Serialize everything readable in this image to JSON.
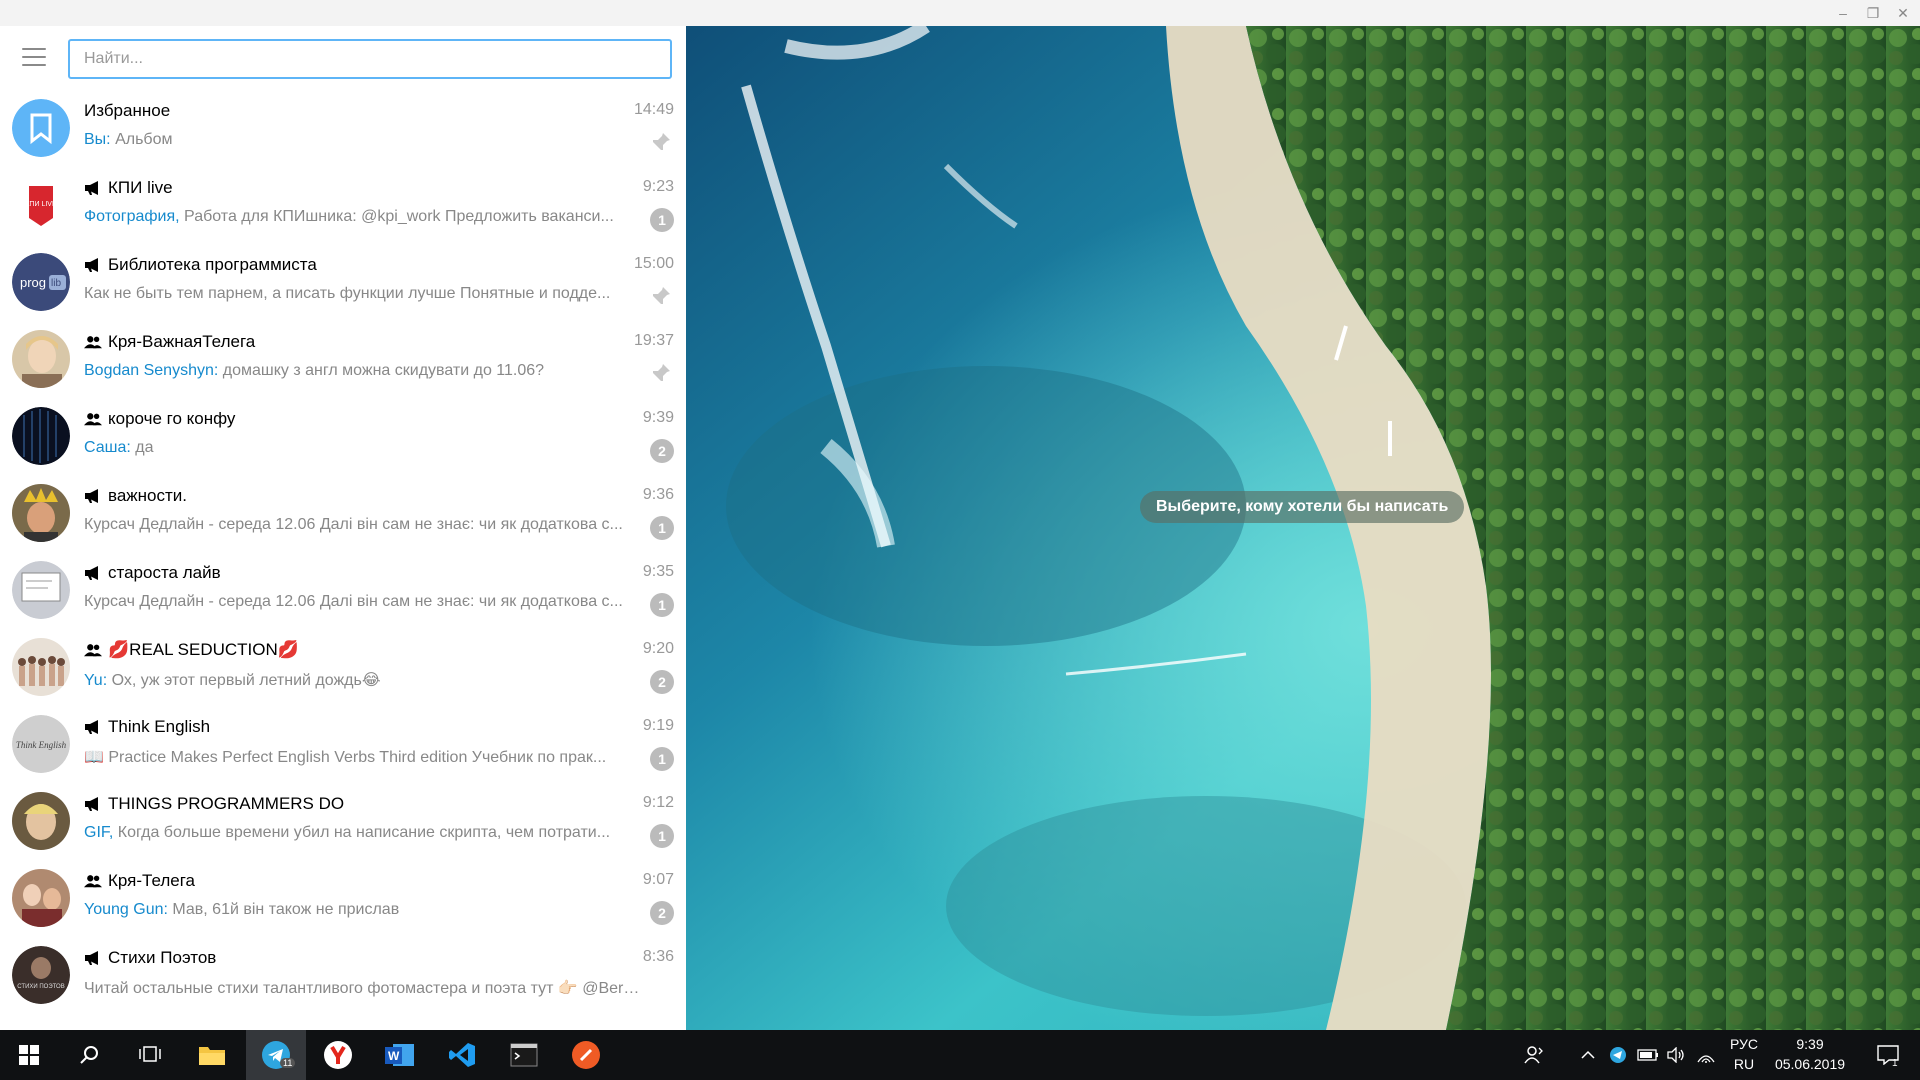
{
  "window": {
    "minimize": "‒",
    "restore": "❐",
    "close": "✕"
  },
  "search": {
    "placeholder": "Найти..."
  },
  "chats": [
    {
      "title": "Избранное",
      "type": "saved",
      "time": "14:49",
      "sender": "Вы:",
      "text": " Альбом",
      "pinned": true,
      "unread": ""
    },
    {
      "title": "КПИ live",
      "type": "channel",
      "time": "9:23",
      "sender": "Фотография,",
      "text": " Работа для КПИшника: @kpi_work  Предложить ваканси...",
      "pinned": false,
      "unread": "1"
    },
    {
      "title": "Библиотека программиста",
      "type": "channel",
      "time": "15:00",
      "sender": "",
      "text": "Как не быть тем парнем, а писать функции лучше  Понятные и подде...",
      "pinned": true,
      "unread": ""
    },
    {
      "title": "Кря-ВажнаяТелега",
      "type": "group",
      "time": "19:37",
      "sender": "Bogdan Senyshyn:",
      "text": " домашку з англ можна скидувати до 11.06?",
      "pinned": true,
      "unread": ""
    },
    {
      "title": "короче го конфу",
      "type": "group",
      "time": "9:39",
      "sender": "Саша:",
      "text": " да",
      "pinned": false,
      "unread": "2"
    },
    {
      "title": "важности.",
      "type": "channel",
      "time": "9:36",
      "sender": "",
      "text": "Курсач Дедлайн - середа 12.06 Далі він сам не знає: чи як додаткова с...",
      "pinned": false,
      "unread": "1"
    },
    {
      "title": "староста лайв",
      "type": "channel",
      "time": "9:35",
      "sender": "",
      "text": "Курсач Дедлайн - середа 12.06 Далі він сам не знає: чи як додаткова с...",
      "pinned": false,
      "unread": "1"
    },
    {
      "title": "💋REAL SEDUCTION💋",
      "type": "group",
      "time": "9:20",
      "sender": "Yu:",
      "text": " Ох, уж этот первый летний дождь😂",
      "pinned": false,
      "unread": "2"
    },
    {
      "title": "Think English",
      "type": "channel",
      "time": "9:19",
      "sender": "",
      "text": "📖 Practice Makes Perfect English Verbs Third edition  Учебник по прак...",
      "pinned": false,
      "unread": "1"
    },
    {
      "title": "THINGS PROGRAMMERS DO",
      "type": "channel",
      "time": "9:12",
      "sender": "GIF,",
      "text": " Когда больше времени убил на написание скрипта, чем потрати...",
      "pinned": false,
      "unread": "1"
    },
    {
      "title": "Кря-Телега",
      "type": "group",
      "time": "9:07",
      "sender": "Young Gun:",
      "text": " Мав, 61й він також не прислав",
      "pinned": false,
      "unread": "2"
    },
    {
      "title": "Стихи Поэтов",
      "type": "channel",
      "time": "8:36",
      "sender": "",
      "text": "Читай остальные стихи талантливого фотомастера и поэта тут 👉🏻 @Berm...",
      "pinned": false,
      "unread": ""
    }
  ],
  "avatars": {
    "kpi": "КПИ LIVE",
    "proglib_a": "prog",
    "proglib_b": "lib",
    "think": "Think English",
    "stihi": "СТИХИ ПОЭТОВ"
  },
  "main": {
    "empty_hint": "Выберите, кому хотели бы написать"
  },
  "taskbar": {
    "telegram_badge": "11",
    "lang_top": "РУС",
    "lang_bottom": "RU",
    "time": "9:39",
    "date": "05.06.2019",
    "notif_count": "1"
  },
  "colors": {
    "accent": "#5eb5f7",
    "link": "#168acd",
    "badge": "#bbbbbb",
    "taskbar": "#0f1113"
  }
}
